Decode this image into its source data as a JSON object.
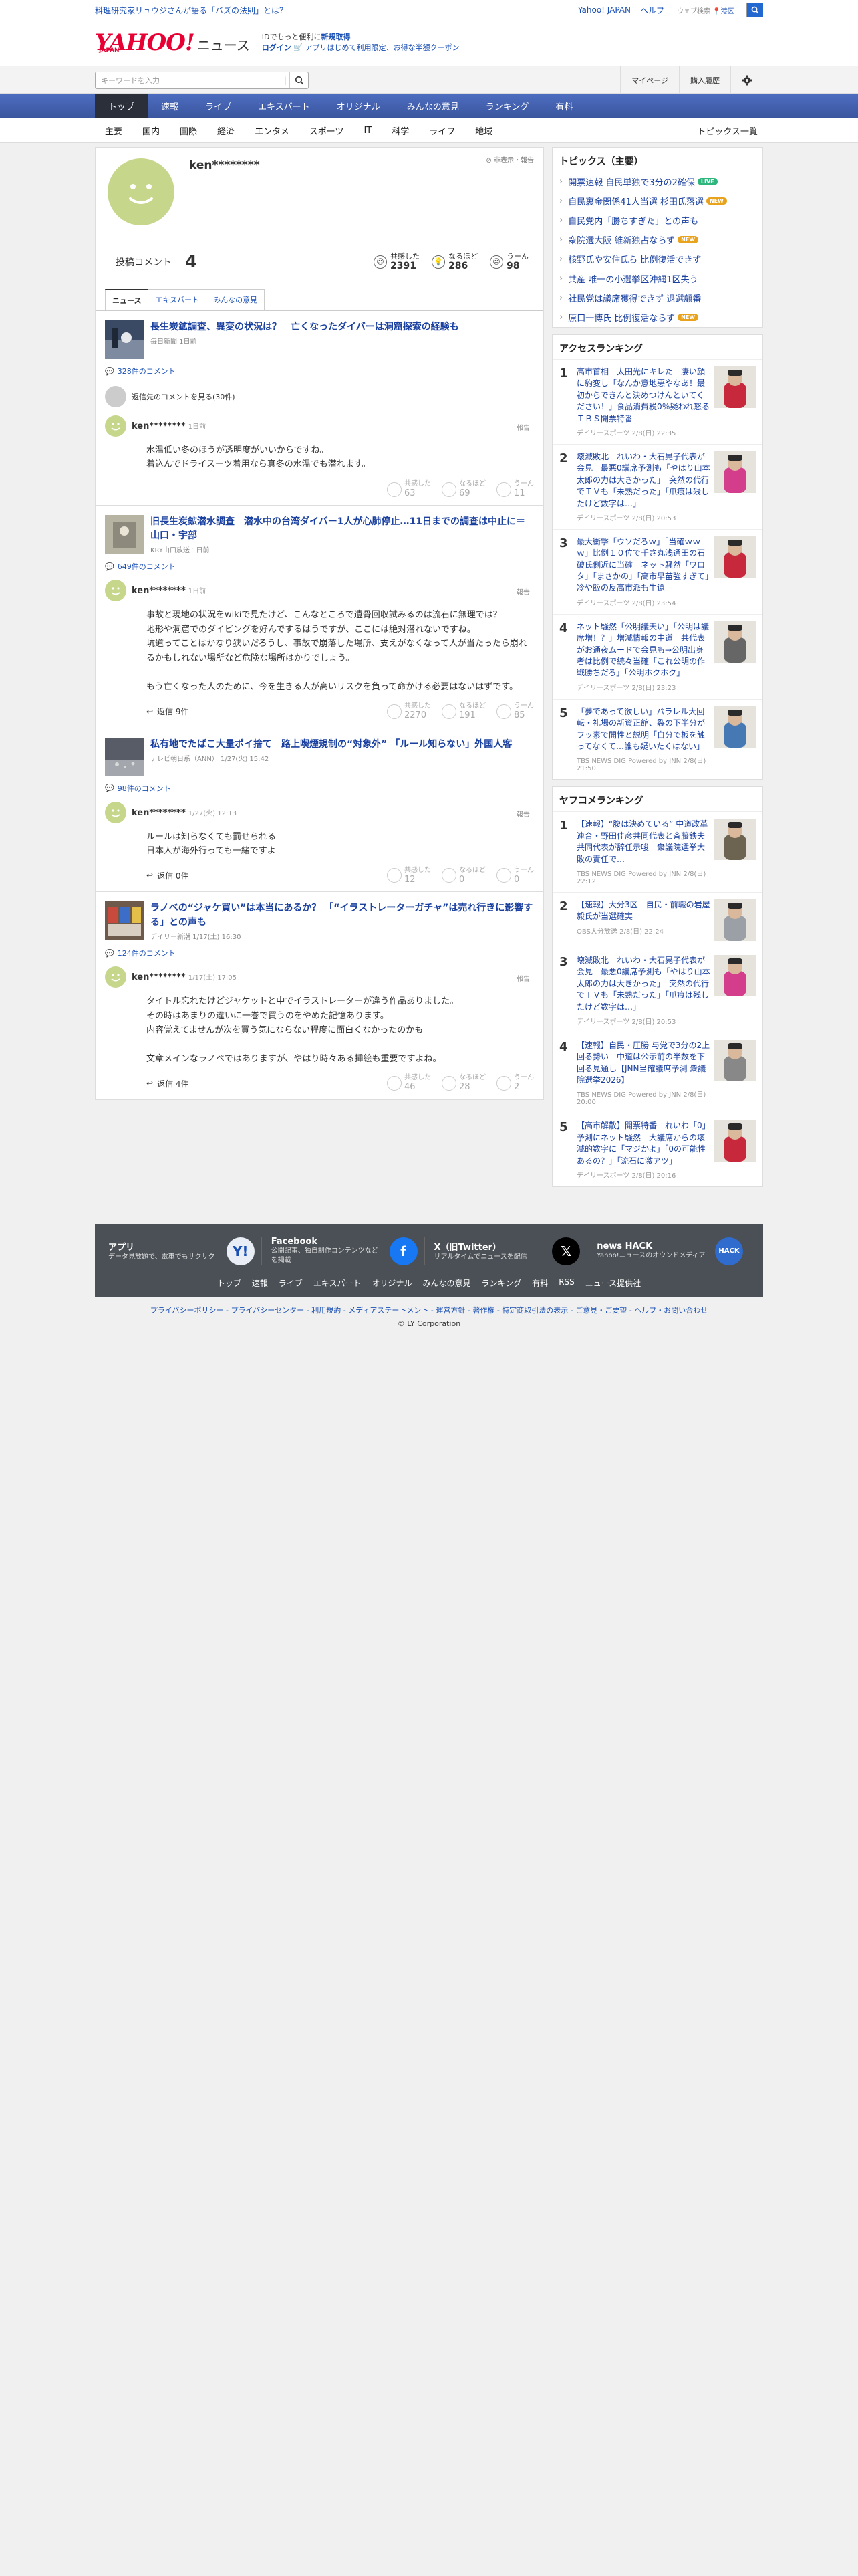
{
  "top": {
    "promo": "料理研究家リュウジさんが語る「バズの法則」とは？",
    "links": [
      "Yahoo! JAPAN",
      "ヘルプ"
    ],
    "search_placeholder": "ウェブ検索",
    "location": "港区"
  },
  "header": {
    "logo": "YAHOO!",
    "logo_sub": "JAPAN",
    "logo_news": "ニュース",
    "info1": "IDでもっと便利に",
    "info1_link": "新規取得",
    "info2_login": "ログイン",
    "info2_text": "アプリはじめて利用限定、お得な半額クーポン"
  },
  "searchbar": {
    "placeholder": "キーワードを入力",
    "items": [
      "マイページ",
      "購入履歴"
    ]
  },
  "mainnav": [
    "トップ",
    "速報",
    "ライブ",
    "エキスパート",
    "オリジナル",
    "みんなの意見",
    "ランキング",
    "有料"
  ],
  "subnav": [
    "主要",
    "国内",
    "国際",
    "経済",
    "エンタメ",
    "スポーツ",
    "IT",
    "科学",
    "ライフ",
    "地域"
  ],
  "subnav_right": "トピックス一覧",
  "profile": {
    "name": "ken********",
    "hide": "非表示・報告",
    "post_label": "投稿コメント",
    "post_count": "4",
    "reactions": [
      {
        "label": "共感した",
        "value": "2391"
      },
      {
        "label": "なるほど",
        "value": "286"
      },
      {
        "label": "うーん",
        "value": "98"
      }
    ],
    "tabs": [
      "ニュース",
      "エキスパート",
      "みんなの意見"
    ]
  },
  "items": [
    {
      "title": "長生炭鉱調査、異変の状況は？　亡くなったダイバーは洞窟探索の経験も",
      "meta": "毎日新聞 1日前",
      "count": "328件のコメント",
      "prev": "返信先のコメントを見る(30件)",
      "user": "ken********",
      "time": "1日前",
      "report": "報告",
      "text": "水温低い冬のほうが透明度がいいからですね。\n着込んでドライスーツ着用なら真冬の水温でも潜れます。",
      "reply": "",
      "r": [
        "63",
        "69",
        "11"
      ]
    },
    {
      "title": "旧長生炭鉱潜水調査　潜水中の台湾ダイバー1人が心肺停止…11日までの調査は中止に＝山口・宇部",
      "meta": "KRY山口放送 1日前",
      "count": "649件のコメント",
      "prev": "",
      "user": "ken********",
      "time": "1日前",
      "report": "報告",
      "text": "事故と現地の状況をwikiで見たけど、こんなところで遺骨回収試みるのは流石に無理では？\n地形や洞窟でのダイビングを好んでするはうですが、ここには絶対潜れないですね。\n坑道ってことはかなり狭いだろうし、事故で崩落した場所、支えがなくなって人が当たったら崩れるかもしれない場所など危険な場所はかりでしょう。\n\nもう亡くなった人のために、今を生きる人が高いリスクを負って命かける必要はないはずです。",
      "reply": "返信 9件",
      "r": [
        "2270",
        "191",
        "85"
      ]
    },
    {
      "title": "私有地でたばこ大量ポイ捨て　路上喫煙規制の“対象外” 「ルール知らない」外国人客",
      "meta": "テレビ朝日系（ANN） 1/27(火) 15:42",
      "count": "98件のコメント",
      "prev": "",
      "user": "ken********",
      "time": "1/27(火) 12:13",
      "report": "報告",
      "text": "ルールは知らなくても罰せられる\n日本人が海外行っても一緒ですよ",
      "reply": "返信 0件",
      "r": [
        "12",
        "0",
        "0"
      ]
    },
    {
      "title": "ラノベの“ジャケ買い”は本当にあるか？ 「“イラストレーターガチャ”は売れ行きに影響する」との声も",
      "meta": "デイリー新潮 1/17(土) 16:30",
      "count": "124件のコメント",
      "prev": "",
      "user": "ken********",
      "time": "1/17(土) 17:05",
      "report": "報告",
      "text": "タイトル忘れたけどジャケットと中でイラストレーターが違う作品ありました。\nその時はあまりの違いに一巻で買うのをやめた記憶あります。\n内容覚えてませんが次を買う気にならない程度に面白くなかったのかも\n\n文章メインなラノベではありますが、やはり時々ある挿絵も重要ですよね。",
      "reply": "返信 4件",
      "r": [
        "46",
        "28",
        "2"
      ]
    }
  ],
  "topics": {
    "heading": "トピックス（主要）",
    "list": [
      {
        "text": "開票速報 自民単独で3分の2確保",
        "badge": "LIVE",
        "color": "#2db67c"
      },
      {
        "text": "自民裏金関係41人当選 杉田氏落選",
        "badge": "NEW",
        "color": "#e8a21c"
      },
      {
        "text": "自民党内「勝ちすぎた」との声も",
        "badge": "",
        "color": ""
      },
      {
        "text": "衆院選大阪 維新独占ならず",
        "badge": "NEW",
        "color": "#e8a21c"
      },
      {
        "text": "核野氏や安住氏ら 比例復活できず",
        "badge": "",
        "color": ""
      },
      {
        "text": "共産 唯一の小選挙区沖縄1区失う",
        "badge": "",
        "color": ""
      },
      {
        "text": "社民党は議席獲得できず 退選顧番",
        "badge": "",
        "color": ""
      },
      {
        "text": "原口一博氏 比例復活ならず",
        "badge": "NEW",
        "color": "#e8a21c"
      }
    ]
  },
  "access": {
    "heading": "アクセスランキング",
    "list": [
      {
        "n": "1",
        "text": "高市首相　太田光にキレた　凄い顔に豹変し「なんか意地悪やなあ！最初からできんと決めつけんといてください！」食品消費税0％疑われ怒る　ＴＢＳ開票特番",
        "src": "デイリースポーツ 2/8(日) 22:35",
        "color": "#c8283c"
      },
      {
        "n": "2",
        "text": "壊滅敗北　れいわ・大石晃子代表が会見　最悪0議席予測も「やはり山本太郎の力は大きかった」　突然の代行でＴＶも「未熟だった」「爪痕は残したけど数字は…」",
        "src": "デイリースポーツ 2/8(日) 20:53",
        "color": "#d43c8c"
      },
      {
        "n": "3",
        "text": "最大衝撃「ウソだろｗ」「当確ｗｗｗ」比例１０位で千さ丸浅通田の石破氏側近に当確　ネット騒然「ワロタ」「まさかの」「高市早苗強すぎて」冷や飯の反高市派も生還",
        "src": "デイリースポーツ 2/8(日) 23:54",
        "color": "#c8283c"
      },
      {
        "n": "4",
        "text": "ネット騒然「公明議天い」「公明は議席増！？」増減情報の中道　共代表がお通夜ムードで会見も→公明出身者は比例で続々当確「これ公明の作戦勝ちだろ」「公明ホクホク」",
        "src": "デイリースポーツ 2/8(日) 23:23",
        "color": "#666"
      },
      {
        "n": "5",
        "text": "「夢であって欲しい」パラレル大回転・礼場の新資正館、裂の下半分がフッ素で開性と説明「自分で板を触ってなくて…誰も疑いたくはない」",
        "src": "TBS NEWS DIG Powered by JNN 2/8(日) 21:50",
        "color": "#4678b4"
      }
    ]
  },
  "yafuko": {
    "heading": "ヤフコメランキング",
    "list": [
      {
        "n": "1",
        "text": "【速報】“腹は決めている” 中道改革連合・野田佳彦共同代表と斉藤鉄夫共同代表が辞任示唆　衆議院選挙大敗の責任で…",
        "src": "TBS NEWS DIG Powered by JNN 2/8(日) 22:12",
        "color": "#6c6450"
      },
      {
        "n": "2",
        "text": "【速報】大分3区　自民・前職の岩屋毅氏が当選確実",
        "src": "OBS大分放送 2/8(日) 22:24",
        "color": "#9aa0a6"
      },
      {
        "n": "3",
        "text": "壊滅敗北　れいわ・大石晃子代表が会見　最悪0議席予測も「やはり山本太郎の力は大きかった」　突然の代行でＴＶも「未熟だった」「爪痕は残したけど数字は…」",
        "src": "デイリースポーツ 2/8(日) 20:53",
        "color": "#d43c8c"
      },
      {
        "n": "4",
        "text": "【速報】自民・圧勝 与党で3分の2上回る勢い　中道は公示前の半数を下回る見通し【JNN当確議席予測 衆議院選挙2026】",
        "src": "TBS NEWS DIG Powered by JNN 2/8(日) 20:00",
        "color": "#888"
      },
      {
        "n": "5",
        "text": "【高市解散】開票特番　れいわ「0」予測にネット騒然　大議席からの壊滅的数字に「マジかよ」「0の可能性あるの？」「流石に激アツ」",
        "src": "デイリースポーツ 2/8(日) 20:16",
        "color": "#c8283c"
      }
    ]
  },
  "footer": {
    "apps": [
      {
        "title": "アプリ",
        "desc": "データ見放題で、電車でもサクサク",
        "icon": "Y!",
        "bg": "#e9edf5",
        "fg": "#1a50b4"
      },
      {
        "title": "Facebook",
        "desc": "公開記事、独自制作コンテンツなどを掲載",
        "icon": "f",
        "bg": "#1877f2",
        "fg": "#fff"
      },
      {
        "title": "X（旧Twitter）",
        "desc": "リアルタイムでニュースを配信",
        "icon": "𝕏",
        "bg": "#000",
        "fg": "#fff"
      },
      {
        "title": "news HACK",
        "desc": "Yahoo!ニュースのオウンドメディア",
        "icon": "HACK",
        "bg": "#2f6ccd",
        "fg": "#fff"
      }
    ],
    "nav": [
      "トップ",
      "速報",
      "ライブ",
      "エキスパート",
      "オリジナル",
      "みんなの意見",
      "ランキング",
      "有料",
      "RSS",
      "ニュース提供社"
    ],
    "legal": "プライバシーポリシー - プライバシーセンター - 利用規約 - メディアステートメント - 運営方針 - 著作権 - 特定商取引法の表示 - ご意見・ご要望 - ヘルプ・お問い合わせ",
    "copyright": "© LY Corporation"
  },
  "colors": {
    "accent": "#1a50b4",
    "nav": "#3b569f",
    "avatar": "#c6d68a"
  }
}
